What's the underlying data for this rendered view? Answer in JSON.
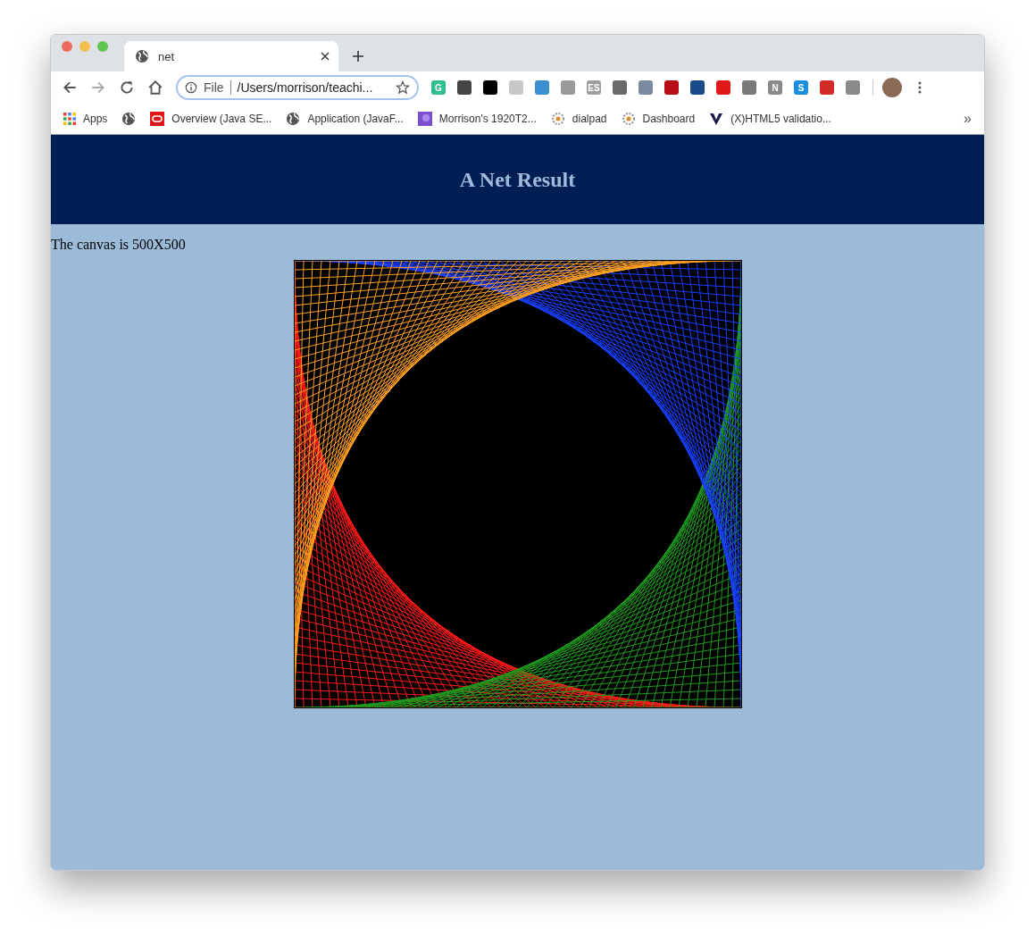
{
  "tab": {
    "title": "net",
    "selected": true
  },
  "address": {
    "scheme": "File",
    "path": "/Users/morrison/teachi..."
  },
  "extensions": [
    {
      "color": "#2fbf8f",
      "glyph": "G"
    },
    {
      "color": "#444444"
    },
    {
      "color": "#000000"
    },
    {
      "color": "#c8c8c8"
    },
    {
      "color": "#3a8fd0"
    },
    {
      "color": "#9a9a9a"
    },
    {
      "color": "#9e9e9e",
      "glyph": "ES"
    },
    {
      "color": "#6a6a6a"
    },
    {
      "color": "#7a8aa0"
    },
    {
      "color": "#b80f17"
    },
    {
      "color": "#1a4a8a"
    },
    {
      "color": "#e01818"
    },
    {
      "color": "#7a7a7a"
    },
    {
      "color": "#8a8a8a",
      "glyph": "N"
    },
    {
      "color": "#1a8fe0",
      "glyph": "S"
    },
    {
      "color": "#d42a2a"
    },
    {
      "color": "#8a8a8a"
    }
  ],
  "bookmarks": [
    {
      "kind": "apps",
      "label": "Apps"
    },
    {
      "kind": "globe"
    },
    {
      "kind": "oracle",
      "label": "Overview (Java SE..."
    },
    {
      "kind": "globe",
      "label": "Application (JavaF..."
    },
    {
      "kind": "purple",
      "label": "Morrison's 1920T2..."
    },
    {
      "kind": "gear",
      "label": "dialpad"
    },
    {
      "kind": "gear",
      "label": "Dashboard"
    },
    {
      "kind": "nu",
      "label": "(X)HTML5 validatio..."
    }
  ],
  "more_bookmarks": "»",
  "page": {
    "heading": "A Net Result",
    "caption": "The canvas is 500X500"
  }
}
